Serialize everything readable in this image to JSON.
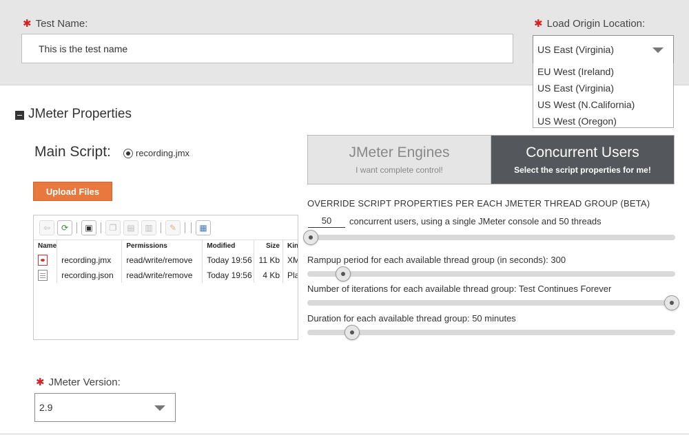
{
  "test_name": {
    "label": "Test Name:",
    "required_mark": "✱",
    "value": "This is the test name"
  },
  "load_origin": {
    "label": "Load Origin Location:",
    "required_mark": "✱",
    "selected": "US East (Virginia)",
    "options": [
      "EU West (Ireland)",
      "US East (Virginia)",
      "US West (N.California)",
      "US West (Oregon)"
    ]
  },
  "section": {
    "title": "JMeter Properties"
  },
  "main_script": {
    "label": "Main Script:",
    "selected_file": "recording.jmx"
  },
  "upload_button": "Upload Files",
  "file_browser": {
    "columns": [
      "Name",
      "Permissions",
      "Modified",
      "Size",
      "Kind"
    ],
    "rows": [
      {
        "icon": "jmx-file-icon",
        "name": "recording.jmx",
        "permissions": "read/write/remove",
        "modified": "Today 19:56",
        "size": "11 Kb",
        "kind": "XML"
      },
      {
        "icon": "text-file-icon",
        "name": "recording.json",
        "permissions": "read/write/remove",
        "modified": "Today 19:56",
        "size": "4 Kb",
        "kind": "Plai"
      }
    ],
    "toolbar_icons": [
      "back-icon",
      "reload-icon",
      "save-icon",
      "copy-icon",
      "paste-icon",
      "duplicate-icon",
      "rename-icon",
      "view-icon"
    ]
  },
  "mode_tabs": {
    "engines": {
      "title": "JMeter Engines",
      "subtitle": "I want complete control!"
    },
    "users": {
      "title": "Concurrent Users",
      "subtitle": "Select the script properties for me!"
    }
  },
  "override": {
    "title": "OVERRIDE SCRIPT PROPERTIES PER EACH JMETER THREAD GROUP (BETA)",
    "users_value": "50",
    "users_text": "concurrent users, using a single JMeter console and 50 threads",
    "users_slider_fraction": 0.0,
    "rampup_label": "Rampup period for each available thread group (in seconds): 300",
    "rampup_slider_fraction": 0.09,
    "iterations_label": "Number of iterations for each available thread group: Test Continues Forever",
    "iterations_slider_fraction": 1.0,
    "duration_label": "Duration for each available thread group: 50 minutes",
    "duration_slider_fraction": 0.115
  },
  "jmeter_version": {
    "label": "JMeter Version:",
    "required_mark": "✱",
    "value": "2.9"
  },
  "colors": {
    "accent_orange": "#e8783e",
    "required_red": "#d42020",
    "active_tab_bg": "#54585c"
  }
}
